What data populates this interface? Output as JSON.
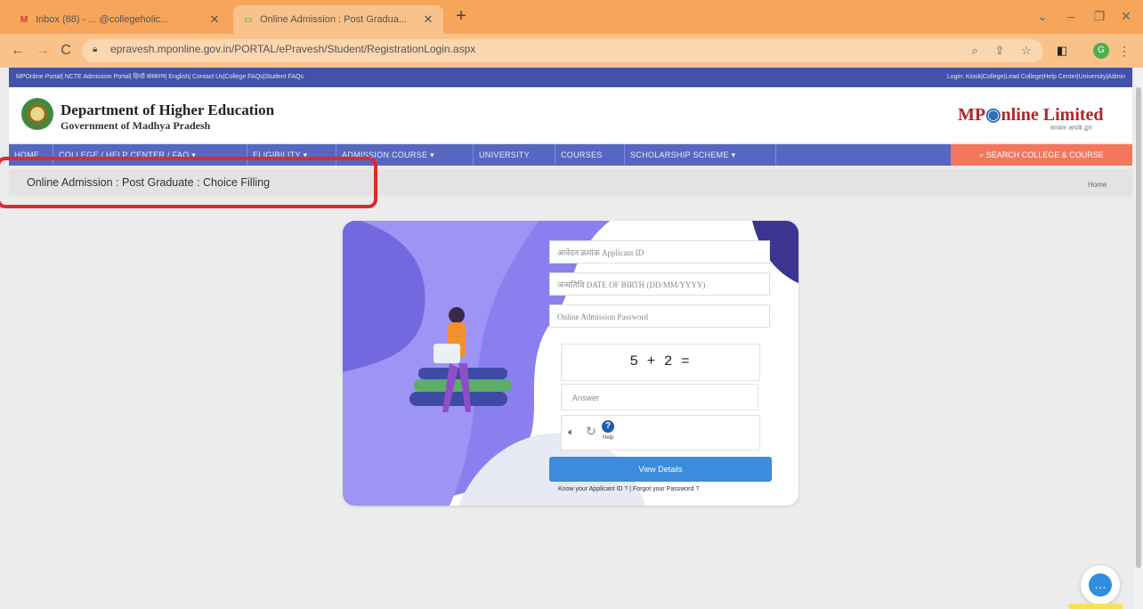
{
  "browser": {
    "tabs": [
      {
        "title": "Inbox (88) - ... @collegeholic...",
        "icon": "gmail-icon"
      },
      {
        "title": "Online Admission : Post Gradua...",
        "icon": "page-icon"
      }
    ],
    "url": "epravesh.mponline.gov.in/PORTAL/ePravesh/Student/RegistrationLogin.aspx",
    "profile_initial": "G"
  },
  "site": {
    "top_links": "MPOnline Portal| NCTE Admission Portal| हिन्दी संस्करण| English| Contact Us|College FAQs|Student FAQs",
    "top_login": "Login: Kiosk|College|Lead College|Help Center|University|Admin",
    "dept_title": "Department of Higher Education",
    "dept_sub": "Government of Madhya Pradesh",
    "partner_logo": "MPOnline Limited",
    "partner_tagline": "सरकार आपके द्वार",
    "nav": [
      "HOME",
      "COLLEGE / HELP CENTER / FAQ ▾",
      "ELIGIBILITY ▾",
      "ADMISSION COURSE ▾",
      "UNIVERSITY",
      "COURSES",
      "SCHOLARSHIP SCHEME ▾"
    ],
    "search_button": "SEARCH COLLEGE & COURSE",
    "breadcrumb": "Online Admission : Post Graduate : Choice Filling",
    "home_link": "Home"
  },
  "form": {
    "applicant_id_placeholder": "आवेदन क्रमांक Applicant ID",
    "dob_placeholder": "जन्मतिथि DATE OF BIRTH (DD/MM/YYYY)",
    "password_placeholder": "Online Admission Password",
    "captcha": "5 + 2 =",
    "answer_placeholder": "Answer",
    "help_label": "Help",
    "view_button": "View Details",
    "links": "Know your Applicant ID ? | Forgot your Password ?"
  },
  "colors": {
    "browser_orange": "#f6a55a",
    "nav_blue": "#5767c1",
    "accent_red": "#e0282e",
    "button_blue": "#3c8bdc",
    "illustration_purple": "#8b7ff0"
  }
}
